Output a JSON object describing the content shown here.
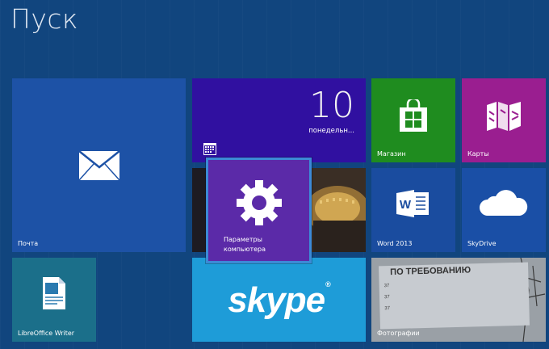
{
  "start": {
    "title": "Пуск"
  },
  "tiles": {
    "mail": {
      "label": "Почта",
      "icon": "mail-icon",
      "color": "#1d52a6"
    },
    "calendar": {
      "day_number": "10",
      "weekday": "понедельн...",
      "icon": "calendar-icon",
      "color": "#3010a0"
    },
    "store": {
      "label": "Магазин",
      "icon": "store-icon",
      "color": "#1f8c1f"
    },
    "maps": {
      "label": "Карты",
      "icon": "maps-icon",
      "color": "#9a1e90"
    },
    "settings": {
      "label_line1": "Параметры",
      "label_line2": "компьютера",
      "icon": "gear-icon",
      "color": "#5b2aa8"
    },
    "word": {
      "label": "Word 2013",
      "icon": "word-icon",
      "color": "#1a4c9f"
    },
    "skydrive": {
      "label": "SkyDrive",
      "icon": "cloud-icon",
      "color": "#1a4fa6"
    },
    "libreoffice": {
      "label": "LibreOffice Writer",
      "icon": "libreoffice-writer-icon",
      "color": "#1b6f8a"
    },
    "skype": {
      "logo_text": "skype",
      "trademark": "®",
      "color": "#1e9cd8"
    },
    "photos": {
      "label": "Фотографии",
      "sign_heading": "ПО ТРЕБОВАНИЮ",
      "sign_lines": [
        "37",
        "37",
        "37"
      ]
    }
  },
  "colors": {
    "background": "#11457e",
    "accent": "#3c8ad6"
  }
}
